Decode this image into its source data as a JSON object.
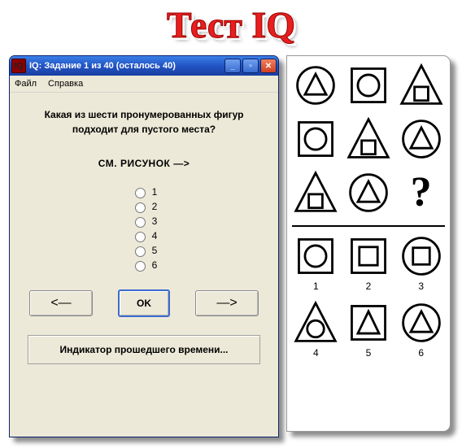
{
  "heading": "Тест IQ",
  "window": {
    "title": "IQ: Задание 1 из 40   (осталось 40)",
    "menu": {
      "file": "Файл",
      "help": "Справка"
    },
    "controls": {
      "min": "_",
      "max": "▫",
      "close": "✕"
    }
  },
  "prompt": "Какая из шести пронумерованных фигур подходит для пустого места?",
  "see_figure": "СМ. РИСУНОК  —>",
  "options": [
    "1",
    "2",
    "3",
    "4",
    "5",
    "6"
  ],
  "buttons": {
    "prev": "<—",
    "ok": "OK",
    "next": "—>"
  },
  "indicator": "Индикатор прошедшего времени...",
  "figure": {
    "question_mark": "?",
    "answers": [
      "1",
      "2",
      "3",
      "4",
      "5",
      "6"
    ]
  }
}
